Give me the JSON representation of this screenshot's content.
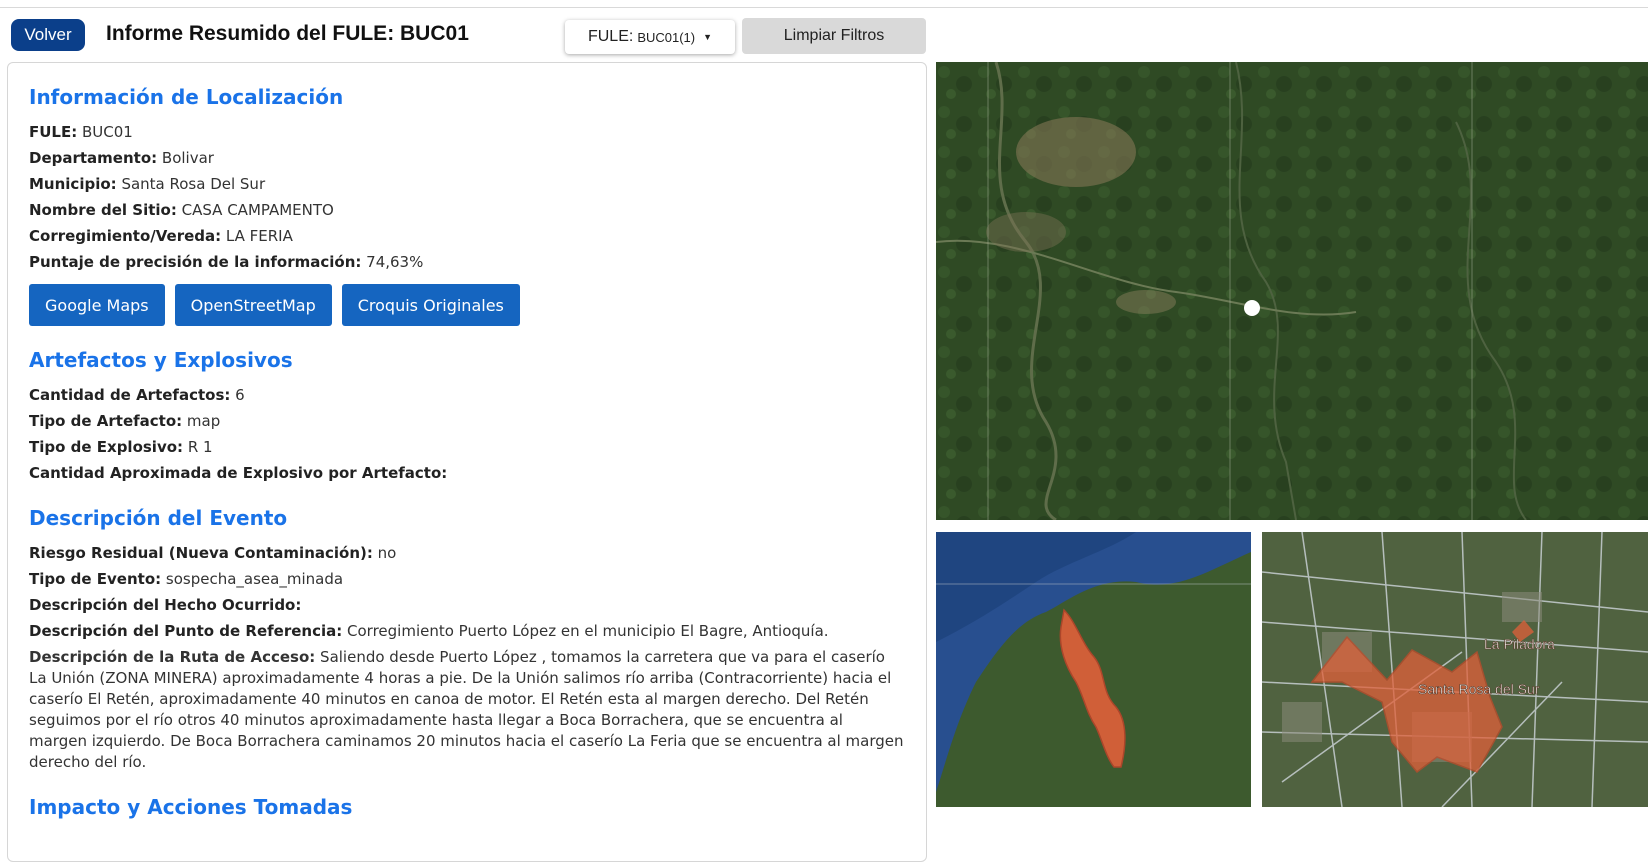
{
  "header": {
    "back_label": "Volver",
    "title": "Informe Resumido del FULE: BUC01",
    "select_prefix": "FULE:",
    "select_value": "BUC01(1)",
    "clear_label": "Limpiar Filtros"
  },
  "localizacion": {
    "title": "Información de Localización",
    "fule_label": "FULE:",
    "fule_value": "BUC01",
    "depto_label": "Departamento:",
    "depto_value": "Bolivar",
    "muni_label": "Municipio:",
    "muni_value": "Santa Rosa Del Sur",
    "sitio_label": "Nombre del Sitio:",
    "sitio_value": "CASA CAMPAMENTO",
    "correg_label": "Corregimiento/Vereda:",
    "correg_value": "LA FERIA",
    "puntaje_label": "Puntaje de precisión de la información:",
    "puntaje_value": "74,63%",
    "buttons": [
      "Google Maps",
      "OpenStreetMap",
      "Croquis Originales"
    ]
  },
  "artefactos": {
    "title": "Artefactos y Explosivos",
    "cantidad_label": "Cantidad de Artefactos:",
    "cantidad_value": "6",
    "tipo_label": "Tipo de Artefacto:",
    "tipo_value": "map",
    "explosivo_label": "Tipo de Explosivo:",
    "explosivo_value": "R 1",
    "aprox_label": "Cantidad Aproximada de Explosivo por Artefacto:",
    "aprox_value": ""
  },
  "evento": {
    "title": "Descripción del Evento",
    "riesgo_label": "Riesgo Residual (Nueva Contaminación):",
    "riesgo_value": "no",
    "tipo_label": "Tipo de Evento:",
    "tipo_value": "sospecha_asea_minada",
    "hecho_label": "Descripción del Hecho Ocurrido:",
    "hecho_value": "",
    "referencia_label": "Descripción del Punto de Referencia:",
    "referencia_value": "Corregimiento Puerto López en el municipio El Bagre, Antioquía.",
    "ruta_label": "Descripción de la Ruta de Acceso:",
    "ruta_value": "Saliendo desde Puerto López , tomamos la carretera que va para el caserío La Unión (ZONA MINERA) aproximadamente 4 horas a pie. De la Unión salimos río arriba (Contracorriente) hacia el caserío El Retén, aproximadamente 40 minutos en canoa de motor. El Retén esta al margen derecho. Del Retén seguimos por el río otros 40 minutos aproximadamente hasta llegar a Boca Borrachera, que se encuentra al margen izquierdo. De Boca Borrachera caminamos 20 minutos hacia el caserío La Feria que se encuentra al margen derecho del río."
  },
  "impacto": {
    "title": "Impacto y Acciones Tomadas"
  },
  "maps": {
    "detail_label_1": "La Piladora",
    "detail_label_2": "Santa Rosa del Sur",
    "accent": "#e0603a"
  }
}
